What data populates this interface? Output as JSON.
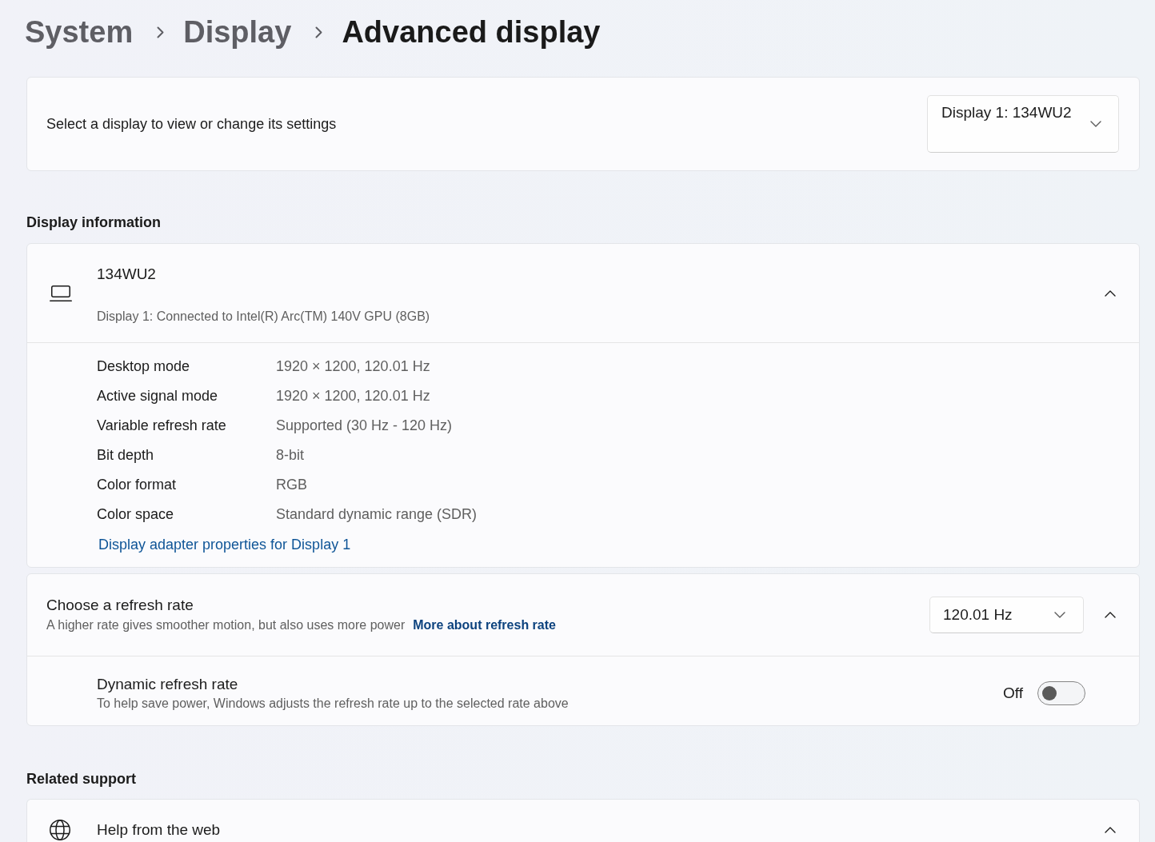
{
  "breadcrumb": [
    {
      "label": "System",
      "current": false
    },
    {
      "label": "Display",
      "current": false
    },
    {
      "label": "Advanced display",
      "current": true
    }
  ],
  "display_selector": {
    "label": "Select a display to view or change its settings",
    "value": "Display 1: 134WU2"
  },
  "display_information": {
    "heading": "Display information",
    "device": {
      "name": "134WU2",
      "description": "Display 1: Connected to Intel(R) Arc(TM) 140V GPU (8GB)",
      "expanded": true
    },
    "properties": [
      {
        "label": "Desktop mode",
        "value": "1920 × 1200, 120.01 Hz"
      },
      {
        "label": "Active signal mode",
        "value": "1920 × 1200, 120.01 Hz"
      },
      {
        "label": "Variable refresh rate",
        "value": "Supported (30 Hz - 120 Hz)"
      },
      {
        "label": "Bit depth",
        "value": "8-bit"
      },
      {
        "label": "Color format",
        "value": "RGB"
      },
      {
        "label": "Color space",
        "value": "Standard dynamic range (SDR)"
      }
    ],
    "link": "Display adapter properties for Display 1"
  },
  "refresh_rate": {
    "title": "Choose a refresh rate",
    "description": "A higher rate gives smoother motion, but also uses more power",
    "link": "More about refresh rate",
    "value": "120.01 Hz",
    "expanded": true,
    "dynamic_refresh": {
      "title": "Dynamic refresh rate",
      "description": "To help save power, Windows adjusts the refresh rate up to the selected rate above",
      "state_label": "Off",
      "on": false
    }
  },
  "related_support": {
    "heading": "Related support",
    "items": [
      {
        "title": "Help from the web",
        "expanded": true
      }
    ]
  }
}
